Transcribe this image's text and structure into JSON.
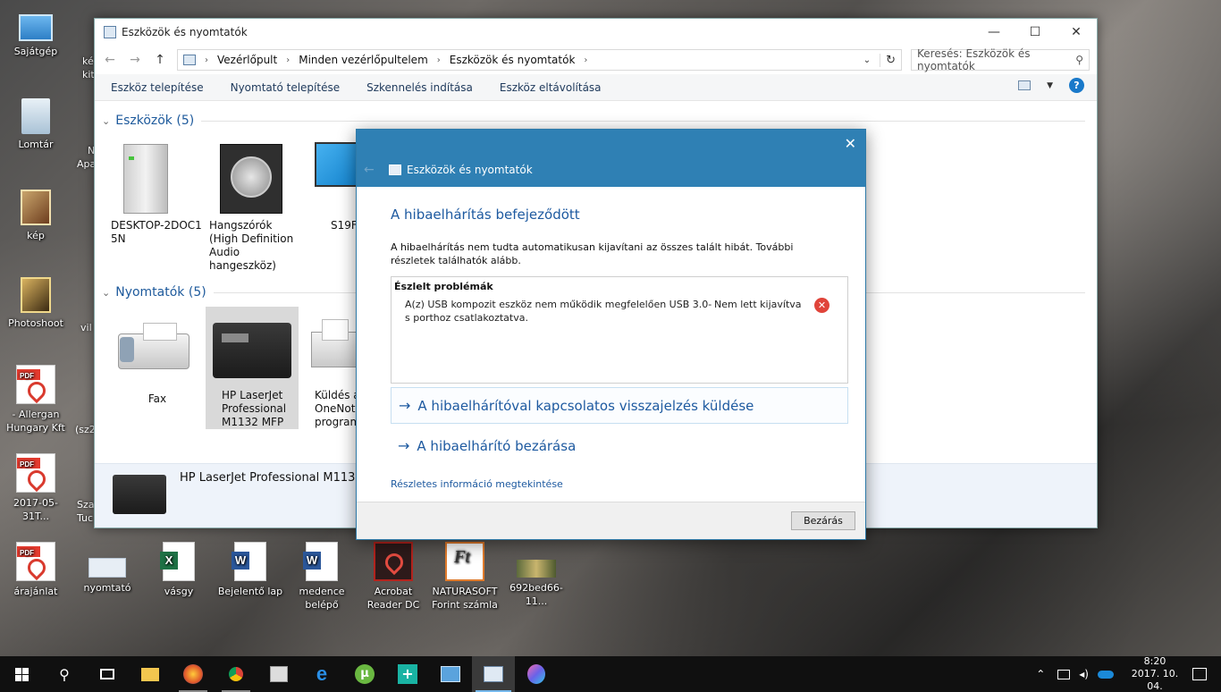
{
  "desktop": {
    "icons": [
      {
        "label": "Sajátgép"
      },
      {
        "label": "Lomtár"
      },
      {
        "label": "kép"
      },
      {
        "label": "Photoshoot"
      },
      {
        "label": "- Allergan Hungary Kft"
      },
      {
        "label": "2017-05-31T..."
      },
      {
        "label": "árajánlat"
      },
      {
        "label": "nyomtató"
      },
      {
        "label": "vásgy"
      },
      {
        "label": "Bejelentő lap"
      },
      {
        "label": "medence belépő"
      },
      {
        "label": "Acrobat Reader DC"
      },
      {
        "label": "NATURASOFT Forint számla"
      },
      {
        "label": "692bed66-11..."
      }
    ],
    "partials": [
      "ké",
      "kit",
      "N",
      "Apa",
      "vil",
      "(sz2",
      "Sza",
      "Tuc"
    ]
  },
  "explorer": {
    "title": "Eszközök és nyomtatók",
    "breadcrumb": [
      "Vezérlőpult",
      "Minden vezérlőpultelem",
      "Eszközök és nyomtatók"
    ],
    "search_placeholder": "Keresés: Eszközök és nyomtatók",
    "toolbar": [
      "Eszköz telepítése",
      "Nyomtató telepítése",
      "Szkennelés indítása",
      "Eszköz eltávolítása"
    ],
    "group_devices": "Eszközök (5)",
    "group_printers": "Nyomtatók (5)",
    "devices": [
      {
        "label": "DESKTOP-2DOC15N"
      },
      {
        "label": "Hangszórók (High Definition Audio hangeszköz)"
      },
      {
        "label": "S19F3"
      }
    ],
    "printers": [
      {
        "label": "Fax"
      },
      {
        "label": "HP LaserJet Professional M1132 MFP"
      },
      {
        "label": "Küldés a OneNote program"
      }
    ],
    "details_name": "HP LaserJet Professional M1132 M"
  },
  "dialog": {
    "window_title": "Eszközök és nyomtatók",
    "heading": "A hibaelhárítás befejeződött",
    "message": "A hibaelhárítás nem tudta automatikusan kijavítani az összes talált hibát. További részletek találhatók alább.",
    "problems_header": "Észlelt problémák",
    "problem_desc": "A(z) USB kompozit eszköz nem működik megfelelően USB 3.0-s porthoz csatlakoztatva.",
    "problem_status": "Nem lett kijavítva",
    "link_feedback": "A hibaelhárítóval kapcsolatos visszajelzés küldése",
    "link_close": "A hibaelhárító bezárása",
    "details_link": "Részletes információ megtekintése",
    "close_button": "Bezárás"
  },
  "taskbar": {
    "time": "8:20",
    "date": "2017. 10. 04."
  }
}
